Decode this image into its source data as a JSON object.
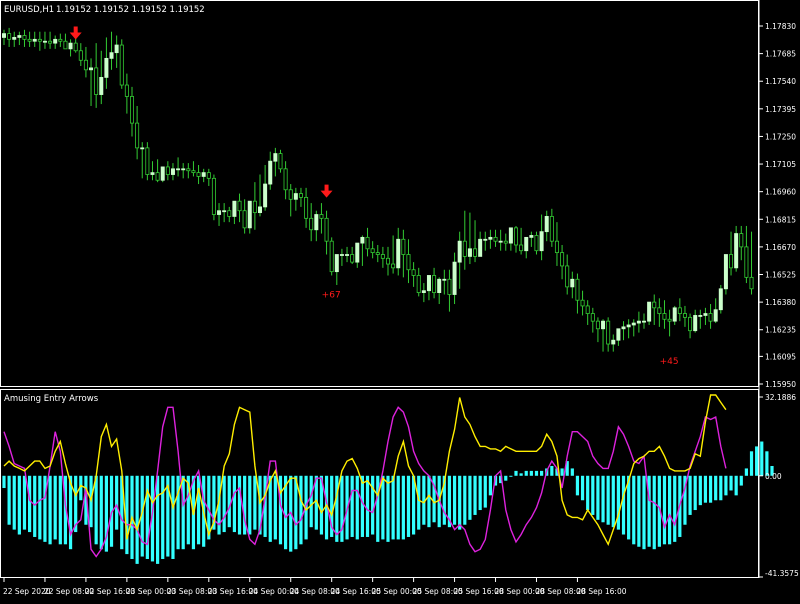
{
  "header": {
    "symbol_label": "EURUSD,H1",
    "quote_values": "1.19152 1.19152 1.19152 1.19152"
  },
  "indicator": {
    "name": "Amusing Entry Arrows",
    "levels": [
      "32.1886",
      "0.00",
      "-41.3575"
    ]
  },
  "price_axis": {
    "ticks": [
      "1.17830",
      "1.17685",
      "1.17540",
      "1.17395",
      "1.17250",
      "1.17105",
      "1.16960",
      "1.16815",
      "1.16670",
      "1.16525",
      "1.16380",
      "1.16235",
      "1.16095",
      "1.15950"
    ]
  },
  "time_axis": {
    "ticks": [
      "22 Sep 2020",
      "22 Sep 08:00",
      "22 Sep 16:00",
      "23 Sep 00:00",
      "23 Sep 08:00",
      "23 Sep 16:00",
      "24 Sep 00:00",
      "24 Sep 08:00",
      "24 Sep 16:00",
      "25 Sep 00:00",
      "25 Sep 08:00",
      "25 Sep 16:00",
      "28 Sep 00:00",
      "28 Sep 08:00",
      "28 Sep 16:00"
    ]
  },
  "signals": {
    "arrows": [
      {
        "bar": 14,
        "price": 1.1778
      },
      {
        "bar": 63,
        "price": 1.1695
      }
    ],
    "labels": [
      {
        "text": "+67",
        "bar": 64,
        "price": 1.1642
      },
      {
        "text": "+45",
        "bar": 130,
        "price": 1.1607
      }
    ]
  },
  "colors": {
    "background": "#000000",
    "bull_candle": "#ccffcc",
    "wick": "#33cc33",
    "histogram": "#33ffff",
    "yellow_line": "#ffee00",
    "magenta_line": "#dd22dd",
    "signal": "#ff1a1a",
    "axis": "#ffffff"
  },
  "chart_data": [
    {
      "type": "candlestick",
      "title": "EURUSD,H1",
      "x_start": "22 Sep 2020 00:00",
      "bar_interval": "1 hour",
      "ylim": [
        1.1595,
        1.179
      ],
      "open": [
        1.1777,
        1.1779,
        1.1776,
        1.1777,
        1.1778,
        1.1776,
        1.1775,
        1.1776,
        1.1775,
        1.1775,
        1.1774,
        1.1776,
        1.1775,
        1.1771,
        1.1774,
        1.177,
        1.1765,
        1.176,
        1.1761,
        1.1747,
        1.1756,
        1.1766,
        1.1769,
        1.1773,
        1.1752,
        1.1746,
        1.1732,
        1.1719,
        1.1719,
        1.1705,
        1.1706,
        1.1702,
        1.1709,
        1.1705,
        1.1708,
        1.1708,
        1.1708,
        1.1707,
        1.1706,
        1.1704,
        1.1706,
        1.1703,
        1.1684,
        1.1686,
        1.1686,
        1.1683,
        1.1691,
        1.1686,
        1.1677,
        1.1691,
        1.1685,
        1.1688,
        1.17,
        1.1712,
        1.1716,
        1.1708,
        1.1697,
        1.1692,
        1.1695,
        1.1693,
        1.1682,
        1.1676,
        1.1684,
        1.1682,
        1.167,
        1.1654,
        1.1663,
        1.1663,
        1.1663,
        1.1659,
        1.1669,
        1.1672,
        1.1666,
        1.1664,
        1.1663,
        1.1661,
        1.1658,
        1.1656,
        1.1671,
        1.1663,
        1.1655,
        1.1652,
        1.1643,
        1.1644,
        1.1652,
        1.1643,
        1.165,
        1.165,
        1.1642,
        1.1659,
        1.167,
        1.1662,
        1.1666,
        1.1662,
        1.1671,
        1.1671,
        1.1672,
        1.167,
        1.167,
        1.1669,
        1.1677,
        1.1668,
        1.1665,
        1.1672,
        1.1673,
        1.1665,
        1.1675,
        1.1683,
        1.167,
        1.1664,
        1.1657,
        1.1646,
        1.165,
        1.1639,
        1.1636,
        1.1632,
        1.1628,
        1.1624,
        1.1628,
        1.1616,
        1.1618,
        1.1624,
        1.1625,
        1.1626,
        1.1627,
        1.1628,
        1.1628,
        1.1638,
        1.1635,
        1.1632,
        1.1629,
        1.1628,
        1.1635,
        1.1632,
        1.163,
        1.1623,
        1.1631,
        1.1631,
        1.1632,
        1.1628,
        1.1634,
        1.1645,
        1.1663,
        1.1656,
        1.1674,
        1.1667,
        1.1651
      ],
      "high": [
        1.1781,
        1.1782,
        1.178,
        1.178,
        1.1781,
        1.178,
        1.178,
        1.178,
        1.178,
        1.178,
        1.1778,
        1.1779,
        1.1779,
        1.1776,
        1.1778,
        1.1774,
        1.1772,
        1.1766,
        1.1774,
        1.177,
        1.1777,
        1.178,
        1.1778,
        1.1776,
        1.1758,
        1.1751,
        1.1741,
        1.1722,
        1.1722,
        1.1712,
        1.1713,
        1.1709,
        1.1712,
        1.1711,
        1.1714,
        1.1711,
        1.1711,
        1.1712,
        1.171,
        1.1708,
        1.1708,
        1.1705,
        1.169,
        1.169,
        1.1688,
        1.1689,
        1.1695,
        1.1692,
        1.169,
        1.1701,
        1.1705,
        1.171,
        1.1717,
        1.1719,
        1.1718,
        1.1712,
        1.17,
        1.1698,
        1.1698,
        1.1698,
        1.169,
        1.1686,
        1.169,
        1.1686,
        1.1672,
        1.1663,
        1.1666,
        1.1667,
        1.1667,
        1.1668,
        1.1673,
        1.1677,
        1.167,
        1.1668,
        1.1667,
        1.1667,
        1.1673,
        1.1677,
        1.1676,
        1.1671,
        1.1659,
        1.1656,
        1.1648,
        1.1652,
        1.1656,
        1.1651,
        1.1655,
        1.1655,
        1.1664,
        1.1675,
        1.1686,
        1.1685,
        1.1681,
        1.1675,
        1.1675,
        1.1676,
        1.1676,
        1.1676,
        1.1674,
        1.1677,
        1.1678,
        1.1677,
        1.1671,
        1.1675,
        1.1675,
        1.1684,
        1.1686,
        1.1687,
        1.168,
        1.1668,
        1.1663,
        1.1654,
        1.1653,
        1.1644,
        1.1639,
        1.1635,
        1.163,
        1.1629,
        1.163,
        1.1621,
        1.1624,
        1.1628,
        1.1629,
        1.1629,
        1.1633,
        1.1632,
        1.1637,
        1.1642,
        1.164,
        1.1639,
        1.1634,
        1.1636,
        1.164,
        1.1636,
        1.1632,
        1.1634,
        1.1634,
        1.1635,
        1.1637,
        1.164,
        1.1647,
        1.1663,
        1.1675,
        1.1678,
        1.1678,
        1.1678,
        1.1675
      ],
      "low": [
        1.1773,
        1.1772,
        1.1772,
        1.1773,
        1.1772,
        1.1772,
        1.1772,
        1.177,
        1.1771,
        1.1771,
        1.1771,
        1.1772,
        1.1771,
        1.1767,
        1.1769,
        1.1762,
        1.1756,
        1.1741,
        1.174,
        1.1742,
        1.175,
        1.176,
        1.1761,
        1.175,
        1.1737,
        1.1725,
        1.1713,
        1.1703,
        1.1702,
        1.1702,
        1.1701,
        1.1701,
        1.1702,
        1.1702,
        1.1704,
        1.1703,
        1.1703,
        1.1704,
        1.17,
        1.1701,
        1.1699,
        1.1681,
        1.1678,
        1.168,
        1.168,
        1.1679,
        1.168,
        1.1674,
        1.1674,
        1.1676,
        1.1683,
        1.1686,
        1.1697,
        1.1704,
        1.1706,
        1.1692,
        1.1683,
        1.1686,
        1.1688,
        1.1677,
        1.167,
        1.167,
        1.1674,
        1.1663,
        1.1652,
        1.1647,
        1.1657,
        1.1659,
        1.1658,
        1.1656,
        1.1657,
        1.1662,
        1.1661,
        1.1659,
        1.1656,
        1.1652,
        1.1653,
        1.1652,
        1.1651,
        1.1648,
        1.1646,
        1.1641,
        1.1638,
        1.1639,
        1.164,
        1.1637,
        1.1642,
        1.1633,
        1.1637,
        1.1645,
        1.1655,
        1.1658,
        1.1659,
        1.1662,
        1.1665,
        1.1666,
        1.1667,
        1.1665,
        1.1665,
        1.1665,
        1.1664,
        1.1663,
        1.1661,
        1.1667,
        1.1663,
        1.166,
        1.167,
        1.1667,
        1.1657,
        1.165,
        1.1642,
        1.164,
        1.1632,
        1.1631,
        1.1626,
        1.1622,
        1.1617,
        1.1612,
        1.1612,
        1.1612,
        1.1615,
        1.1618,
        1.1619,
        1.162,
        1.1622,
        1.1624,
        1.1626,
        1.1626,
        1.1625,
        1.1624,
        1.162,
        1.1626,
        1.1628,
        1.1625,
        1.1619,
        1.1622,
        1.1624,
        1.1626,
        1.1624,
        1.1627,
        1.1632,
        1.1642,
        1.1652,
        1.1654,
        1.166,
        1.1648,
        1.1642
      ],
      "close": [
        1.1779,
        1.1776,
        1.1777,
        1.1778,
        1.1776,
        1.1775,
        1.1776,
        1.1775,
        1.1775,
        1.1774,
        1.1776,
        1.1775,
        1.1771,
        1.1774,
        1.177,
        1.1765,
        1.176,
        1.1761,
        1.1747,
        1.1756,
        1.1766,
        1.1769,
        1.1773,
        1.1752,
        1.1746,
        1.1732,
        1.1719,
        1.1719,
        1.1705,
        1.1706,
        1.1702,
        1.1709,
        1.1705,
        1.1708,
        1.1708,
        1.1708,
        1.1707,
        1.1706,
        1.1704,
        1.1706,
        1.1703,
        1.1684,
        1.1686,
        1.1686,
        1.1683,
        1.1691,
        1.1686,
        1.1677,
        1.1691,
        1.1685,
        1.1688,
        1.17,
        1.1712,
        1.1716,
        1.1708,
        1.1697,
        1.1692,
        1.1695,
        1.1693,
        1.1682,
        1.1676,
        1.1684,
        1.1682,
        1.167,
        1.1654,
        1.1663,
        1.1663,
        1.1663,
        1.1659,
        1.1669,
        1.1672,
        1.1666,
        1.1664,
        1.1663,
        1.1661,
        1.1658,
        1.1656,
        1.1671,
        1.1663,
        1.1655,
        1.1652,
        1.1643,
        1.1644,
        1.1652,
        1.1643,
        1.165,
        1.165,
        1.1642,
        1.1659,
        1.167,
        1.1662,
        1.1666,
        1.1662,
        1.1671,
        1.1671,
        1.1672,
        1.167,
        1.167,
        1.1669,
        1.1677,
        1.1668,
        1.1665,
        1.1672,
        1.1673,
        1.1665,
        1.1675,
        1.1683,
        1.167,
        1.1664,
        1.1657,
        1.1646,
        1.165,
        1.1639,
        1.1636,
        1.1632,
        1.1628,
        1.1624,
        1.1628,
        1.1616,
        1.1618,
        1.1624,
        1.1625,
        1.1626,
        1.1627,
        1.1628,
        1.1628,
        1.1638,
        1.1635,
        1.1632,
        1.1629,
        1.1628,
        1.1635,
        1.1632,
        1.163,
        1.1623,
        1.1631,
        1.1631,
        1.1632,
        1.1628,
        1.1634,
        1.1645,
        1.1663,
        1.1656,
        1.1674,
        1.1667,
        1.1651,
        1.1645
      ]
    },
    {
      "type": "bar",
      "title": "Amusing Entry Arrows",
      "ylim": [
        -41.3575,
        32.1886
      ],
      "values": [
        -5,
        -20,
        -22,
        -24,
        -22,
        -23,
        -25,
        -26,
        -27,
        -28,
        -26,
        -28,
        -28,
        -30,
        -23,
        -10,
        -20,
        -21,
        -28,
        -30,
        -31,
        -29,
        -22,
        -30,
        -32,
        -34,
        -36,
        -33,
        -34,
        -35,
        -36,
        -34,
        -33,
        -34,
        -30,
        -30,
        -28,
        -30,
        -28,
        -29,
        -26,
        -22,
        -24,
        -23,
        -21,
        -23,
        -24,
        -24,
        -24,
        -22,
        -24,
        -25,
        -27,
        -26,
        -28,
        -30,
        -31,
        -30,
        -28,
        -26,
        -21,
        -22,
        -24,
        -26,
        -25,
        -27,
        -27,
        -26,
        -25,
        -26,
        -25,
        -25,
        -24,
        -27,
        -26,
        -27,
        -26,
        -26,
        -26,
        -25,
        -24,
        -22,
        -20,
        -21,
        -19,
        -21,
        -20,
        -21,
        -20,
        -22,
        -20,
        -18,
        -16,
        -14,
        -13,
        -8,
        -4,
        -3,
        -2,
        0,
        2,
        1,
        2,
        2,
        2,
        2,
        3,
        4,
        3,
        3,
        6,
        3,
        -8,
        -10,
        -14,
        -16,
        -18,
        -19,
        -20,
        -21,
        -22,
        -24,
        -26,
        -28,
        -29,
        -30,
        -29,
        -30,
        -29,
        -28,
        -28,
        -27,
        -25,
        -20,
        -16,
        -14,
        -12,
        -11,
        -11,
        -10,
        -10,
        -8,
        -6,
        -8,
        -4,
        3,
        10,
        12,
        14,
        10,
        4
      ],
      "yellow_line": [
        4,
        6,
        4,
        3,
        2,
        4,
        6,
        6,
        3,
        4,
        10,
        14,
        5,
        -3,
        -8,
        -4,
        -5,
        -10,
        0,
        16,
        21,
        12,
        15,
        2,
        -26,
        -17,
        -22,
        -15,
        -6,
        -11,
        -8,
        -7,
        -4,
        -13,
        -7,
        -1,
        -3,
        -16,
        -5,
        -15,
        -24,
        -19,
        -10,
        4,
        9,
        21,
        28,
        27,
        26,
        4,
        -11,
        -8,
        -2,
        2,
        -7,
        -4,
        -1,
        -1,
        -10,
        -14,
        -12,
        -10,
        -15,
        -12,
        -16,
        -8,
        2,
        6,
        7,
        3,
        -3,
        -2,
        -5,
        -8,
        -1,
        -3,
        -2,
        8,
        14,
        4,
        0,
        -10,
        -11,
        -8,
        -11,
        -10,
        -3,
        10,
        19,
        32,
        24,
        21,
        16,
        12,
        12,
        11,
        11,
        10,
        12,
        11,
        10,
        10,
        10,
        10,
        10,
        12,
        17,
        14,
        8,
        -10,
        -16,
        -17,
        -17,
        -18,
        -14,
        -17,
        -20,
        -24,
        -28,
        -22,
        -16,
        -8,
        -2,
        5,
        7,
        8,
        10,
        10,
        12,
        8,
        3,
        2,
        2,
        2,
        3,
        9,
        8,
        22,
        33,
        33,
        30,
        27
      ],
      "magenta_line": [
        18,
        12,
        5,
        4,
        3,
        -10,
        -12,
        -10,
        -9,
        4,
        18,
        10,
        -12,
        -24,
        -20,
        -18,
        -5,
        -30,
        -33,
        -30,
        -25,
        -15,
        -12,
        -18,
        -20,
        -20,
        -22,
        -27,
        -28,
        -15,
        2,
        20,
        28,
        28,
        10,
        -12,
        -8,
        -2,
        2,
        -10,
        -14,
        -18,
        -20,
        -17,
        -13,
        -7,
        -5,
        -18,
        -26,
        -28,
        -22,
        -9,
        6,
        6,
        -12,
        -17,
        -15,
        -20,
        -18,
        -12,
        -8,
        -1,
        -1,
        -11,
        -21,
        -24,
        -22,
        -14,
        -6,
        -6,
        -11,
        -14,
        -15,
        -8,
        2,
        14,
        24,
        28,
        26,
        20,
        10,
        5,
        2,
        0,
        -4,
        -10,
        -15,
        -18,
        -22,
        -20,
        -22,
        -28,
        -31,
        -30,
        -26,
        -14,
        0,
        2,
        -14,
        -22,
        -27,
        -24,
        -20,
        -17,
        -13,
        -7,
        2,
        6,
        3,
        -5,
        8,
        18,
        18,
        16,
        14,
        8,
        5,
        3,
        3,
        10,
        20,
        17,
        12,
        6,
        5,
        8,
        -10,
        -11,
        -13,
        -21,
        -16,
        -20,
        -12,
        -5,
        4,
        10,
        16,
        24,
        23,
        24,
        12,
        3
      ]
    }
  ]
}
